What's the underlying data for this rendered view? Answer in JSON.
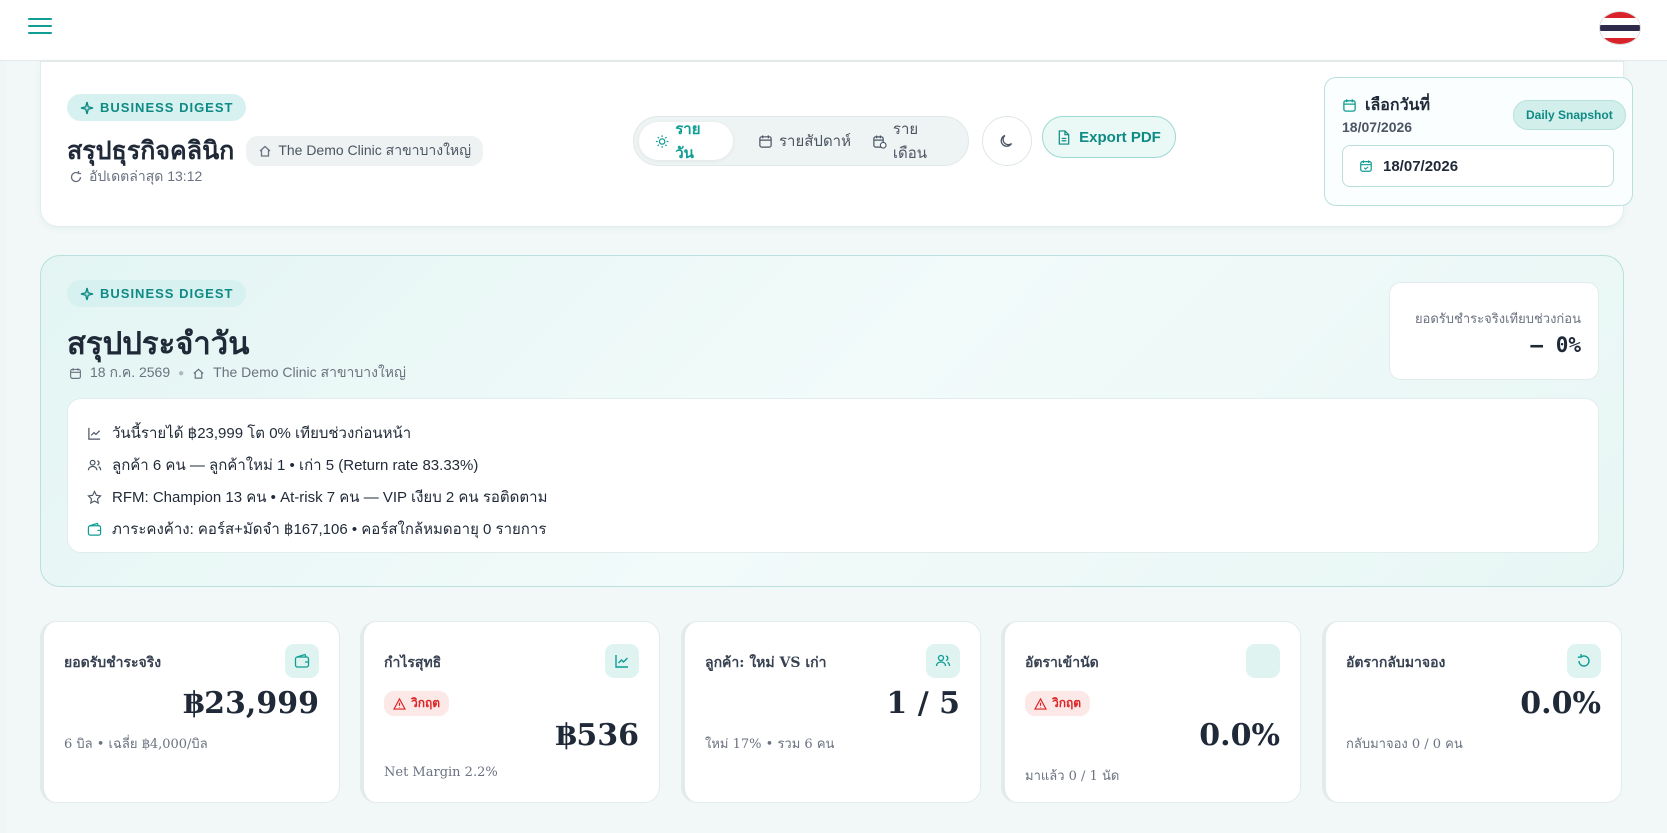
{
  "header": {
    "flag_colors": [
      "#d8232a",
      "#ffffff",
      "#2d2a4a",
      "#ffffff",
      "#d8232a"
    ]
  },
  "top_card": {
    "badge": "BUSINESS DIGEST",
    "title": "สรุปธุรกิจคลินิก",
    "branch": "The Demo Clinic สาขาบางใหญ่",
    "updated": "อัปเดตล่าสุด 13:12",
    "tabs": [
      {
        "label": "รายวัน",
        "active": true,
        "icon": "sun-icon"
      },
      {
        "label": "รายสัปดาห์",
        "active": false,
        "icon": "calendar-icon"
      },
      {
        "label": "รายเดือน",
        "active": false,
        "icon": "calendar-clock-icon"
      }
    ],
    "export_label": "Export PDF",
    "date_picker": {
      "label": "เลือกวันที่",
      "date_text": "18/07/2026",
      "badge": "Daily Snapshot",
      "input_value": "18/07/2026"
    }
  },
  "digest": {
    "badge": "BUSINESS DIGEST",
    "title": "สรุปประจำวัน",
    "date": "18 ก.ค. 2569",
    "branch": "The Demo Clinic สาขาบางใหญ่",
    "compare_label": "ยอดรับชำระจริงเทียบช่วงก่อน",
    "compare_value": "— 0%",
    "lines": [
      {
        "icon": "trend-icon",
        "text": "วันนี้รายได้ ฿23,999 โต 0% เทียบช่วงก่อนหน้า"
      },
      {
        "icon": "users-icon",
        "text": "ลูกค้า 6 คน — ลูกค้าใหม่ 1 • เก่า 5 (Return rate 83.33%)"
      },
      {
        "icon": "star-icon",
        "text": "RFM: Champion 13 คน • At-risk 7 คน — VIP เงียบ 2 คน รอติดตาม"
      },
      {
        "icon": "wallet-icon",
        "text": "ภาระคงค้าง: คอร์ส+มัดจำ ฿167,106 • คอร์สใกล้หมดอายุ 0 รายการ"
      }
    ]
  },
  "kpis": [
    {
      "title": "ยอดรับชำระจริง",
      "value": "฿23,999",
      "sub": "6 บิล • เฉลี่ย ฿4,000/บิล",
      "icon": "wallet-icon",
      "critical": false
    },
    {
      "title": "กำไรสุทธิ",
      "value": "฿536",
      "sub": "Net Margin 2.2%",
      "icon": "trend-icon",
      "critical": true,
      "critical_label": "วิกฤต"
    },
    {
      "title": "ลูกค้า: ใหม่ VS เก่า",
      "value": "1 / 5",
      "sub": "ใหม่ 17% • รวม 6 คน",
      "icon": "users-icon",
      "critical": false
    },
    {
      "title": "อัตราเข้านัด",
      "value": "0.0%",
      "sub": "มาแล้ว 0 / 1 นัด",
      "icon": "blank-icon",
      "critical": true,
      "critical_label": "วิกฤต"
    },
    {
      "title": "อัตรากลับมาจอง",
      "value": "0.0%",
      "sub": "กลับมาจอง 0 / 0 คน",
      "icon": "refresh-icon",
      "critical": false
    }
  ],
  "colors": {
    "accent": "#0f9d94",
    "critical": "#dc2626"
  }
}
